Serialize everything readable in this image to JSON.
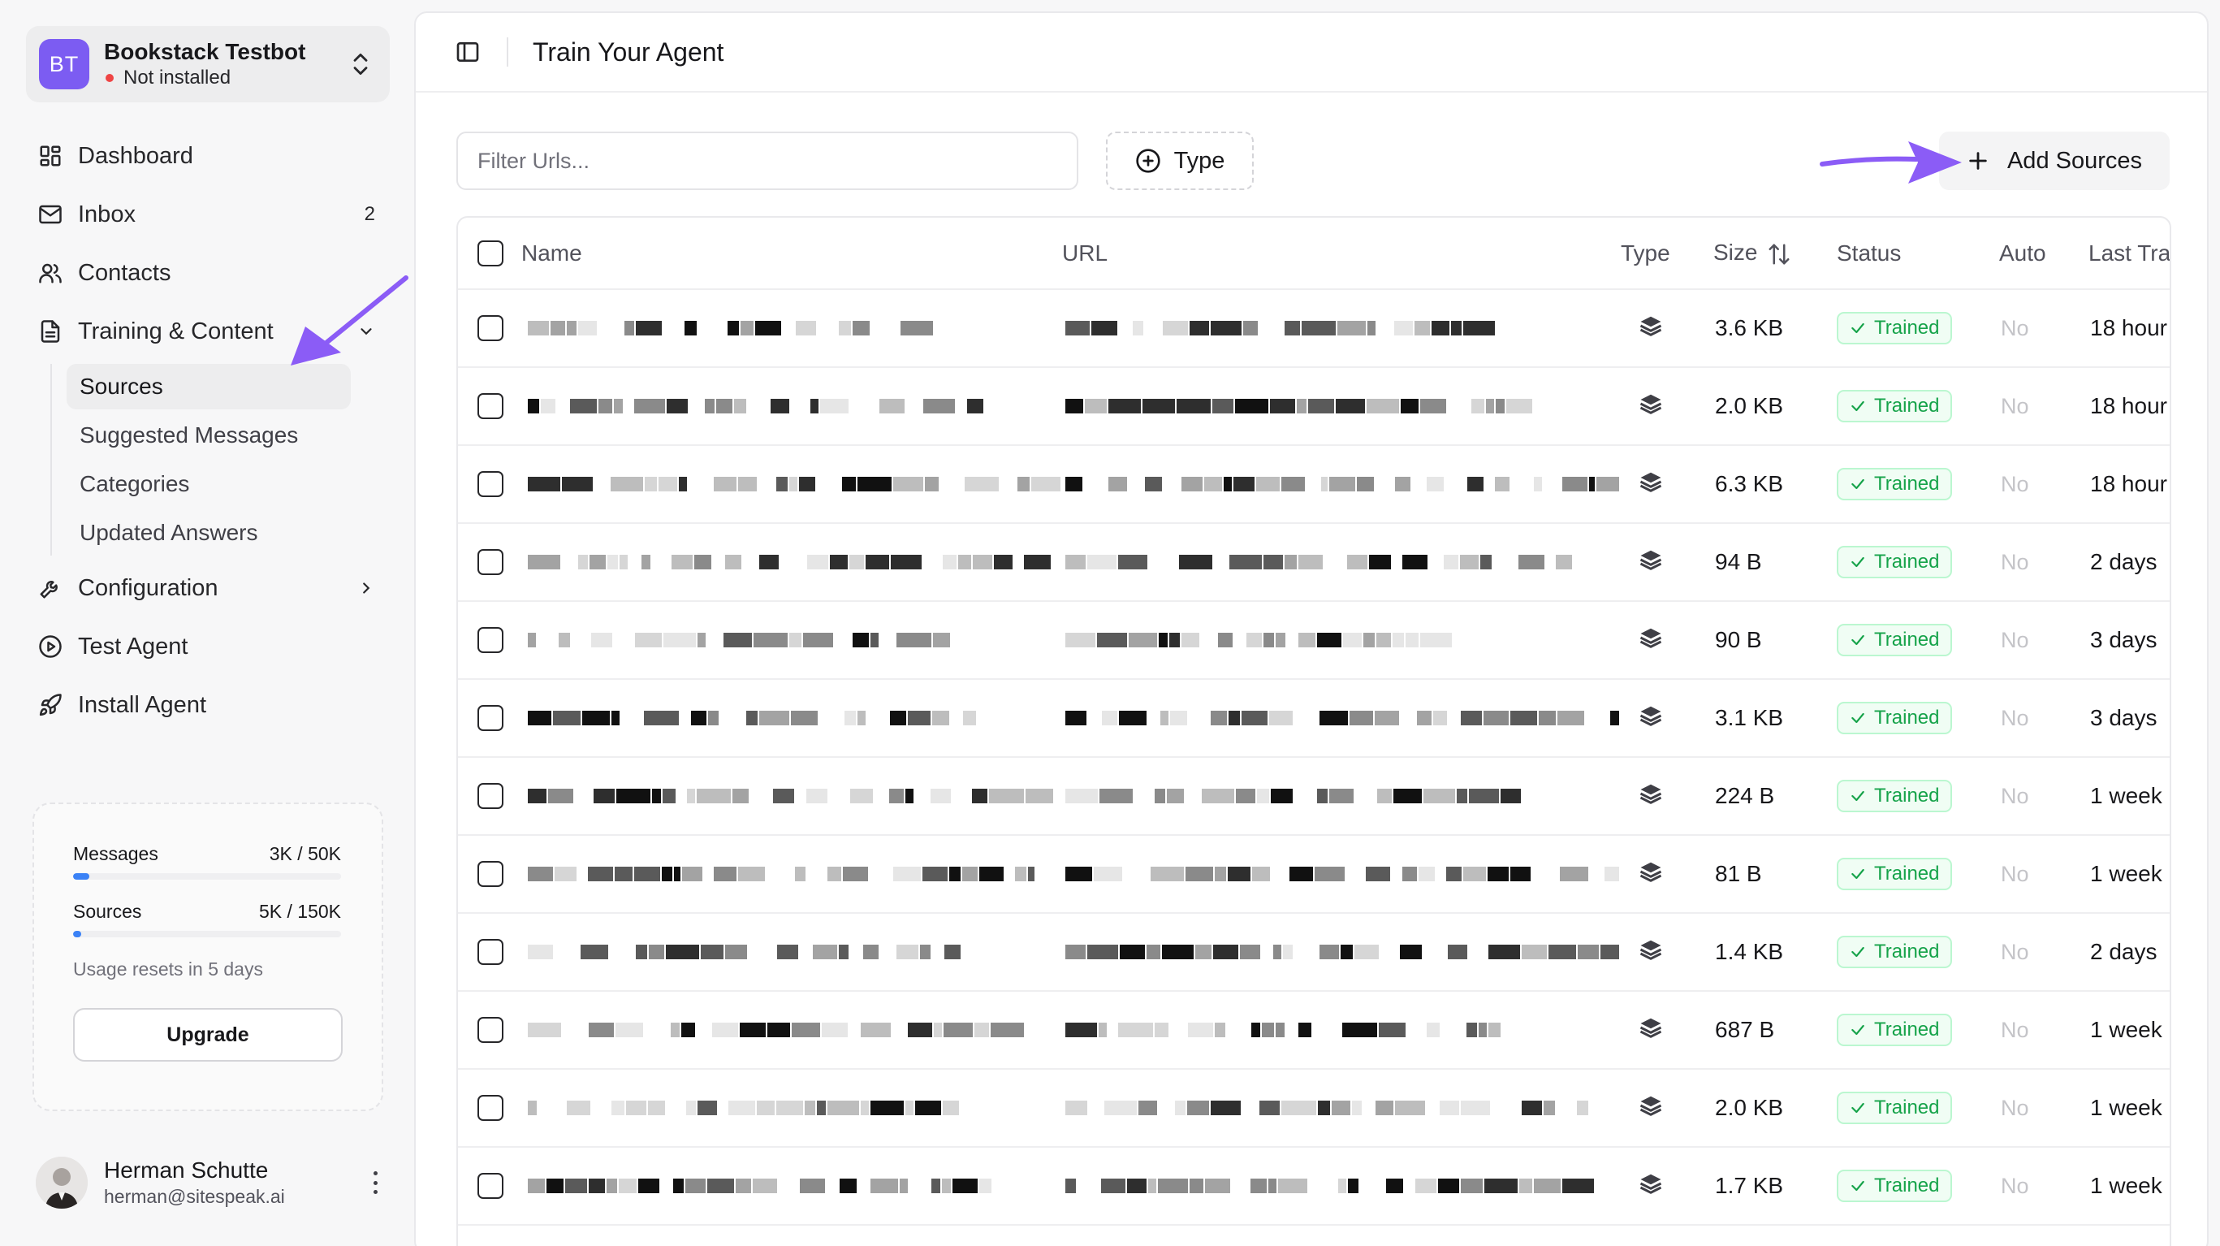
{
  "workspace": {
    "initials": "BT",
    "name": "Bookstack Testbot",
    "status": "Not installed",
    "accent": "#7c5cf2"
  },
  "nav": {
    "dashboard": "Dashboard",
    "inbox": "Inbox",
    "inbox_count": "2",
    "contacts": "Contacts",
    "training": "Training & Content",
    "sub": {
      "sources": "Sources",
      "suggested": "Suggested Messages",
      "categories": "Categories",
      "updated": "Updated Answers"
    },
    "configuration": "Configuration",
    "test_agent": "Test Agent",
    "install_agent": "Install Agent"
  },
  "usage": {
    "messages_label": "Messages",
    "messages_value": "3K / 50K",
    "messages_fraction": 0.06,
    "sources_label": "Sources",
    "sources_value": "5K / 150K",
    "sources_fraction": 0.03,
    "reset_text": "Usage resets in 5 days",
    "upgrade_label": "Upgrade"
  },
  "user": {
    "name": "Herman Schutte",
    "email": "herman@sitespeak.ai"
  },
  "page": {
    "title": "Train Your Agent",
    "filter_placeholder": "Filter Urls...",
    "type_button": "Type",
    "add_sources_button": "Add Sources"
  },
  "table": {
    "headers": {
      "name": "Name",
      "url": "URL",
      "type": "Type",
      "size": "Size",
      "status": "Status",
      "auto": "Auto",
      "last_trained": "Last Tra"
    },
    "rows": [
      {
        "size": "3.6 KB",
        "status": "Trained",
        "auto": "No",
        "last": "18 hour"
      },
      {
        "size": "2.0 KB",
        "status": "Trained",
        "auto": "No",
        "last": "18 hour"
      },
      {
        "size": "6.3 KB",
        "status": "Trained",
        "auto": "No",
        "last": "18 hour"
      },
      {
        "size": "94 B",
        "status": "Trained",
        "auto": "No",
        "last": "2 days"
      },
      {
        "size": "90 B",
        "status": "Trained",
        "auto": "No",
        "last": "3 days"
      },
      {
        "size": "3.1 KB",
        "status": "Trained",
        "auto": "No",
        "last": "3 days"
      },
      {
        "size": "224 B",
        "status": "Trained",
        "auto": "No",
        "last": "1 week"
      },
      {
        "size": "81 B",
        "status": "Trained",
        "auto": "No",
        "last": "1 week"
      },
      {
        "size": "1.4 KB",
        "status": "Trained",
        "auto": "No",
        "last": "2 days"
      },
      {
        "size": "687 B",
        "status": "Trained",
        "auto": "No",
        "last": "1 week"
      },
      {
        "size": "2.0 KB",
        "status": "Trained",
        "auto": "No",
        "last": "1 week"
      },
      {
        "size": "1.7 KB",
        "status": "Trained",
        "auto": "No",
        "last": "1 week"
      }
    ]
  },
  "colors": {
    "annotation_arrow": "#8b5cf6",
    "trained_green": "#16a34a",
    "status_red": "#ef4444",
    "usage_blue": "#3b82f6"
  }
}
